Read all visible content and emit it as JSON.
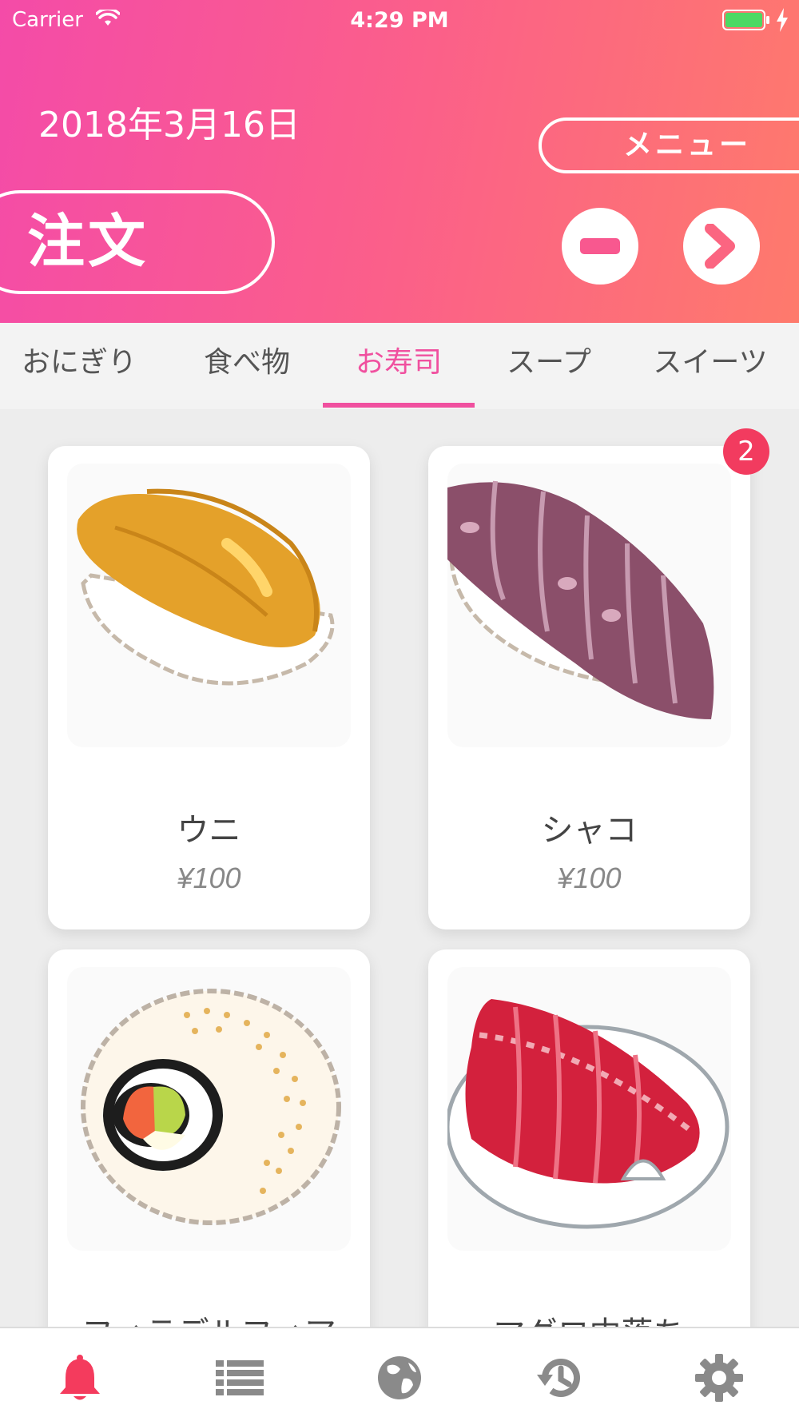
{
  "status_bar": {
    "carrier": "Carrier",
    "time": "4:29 PM"
  },
  "header": {
    "date": "2018年3月16日",
    "menu_label": "メニュー",
    "order_label": "注文",
    "gradient": [
      "#f44ba8",
      "#fe7a6c"
    ]
  },
  "tabs": [
    {
      "label": "おにぎり"
    },
    {
      "label": "食べ物"
    },
    {
      "label": "お寿司",
      "active": true
    },
    {
      "label": "スープ"
    },
    {
      "label": "スイーツ"
    }
  ],
  "items": [
    {
      "name": "ウニ",
      "price": "¥100",
      "icon": "uni-sushi-illustration"
    },
    {
      "name": "シャコ",
      "price": "¥100",
      "icon": "shako-sushi-illustration",
      "badge": "2"
    },
    {
      "name": "フィラデルフィア",
      "price": "",
      "icon": "philadelphia-roll-illustration"
    },
    {
      "name": "マグロ中落ち",
      "price": "",
      "icon": "maguro-nakaochi-illustration"
    }
  ],
  "tab_bar": [
    {
      "icon": "bell-icon",
      "active": true
    },
    {
      "icon": "list-icon"
    },
    {
      "icon": "globe-icon"
    },
    {
      "icon": "history-icon"
    },
    {
      "icon": "settings-icon"
    }
  ],
  "colors": {
    "accent": "#f0509f",
    "badge": "#f23b5f",
    "bell_active": "#f43b5d",
    "icon_inactive": "#8a8a8a"
  }
}
